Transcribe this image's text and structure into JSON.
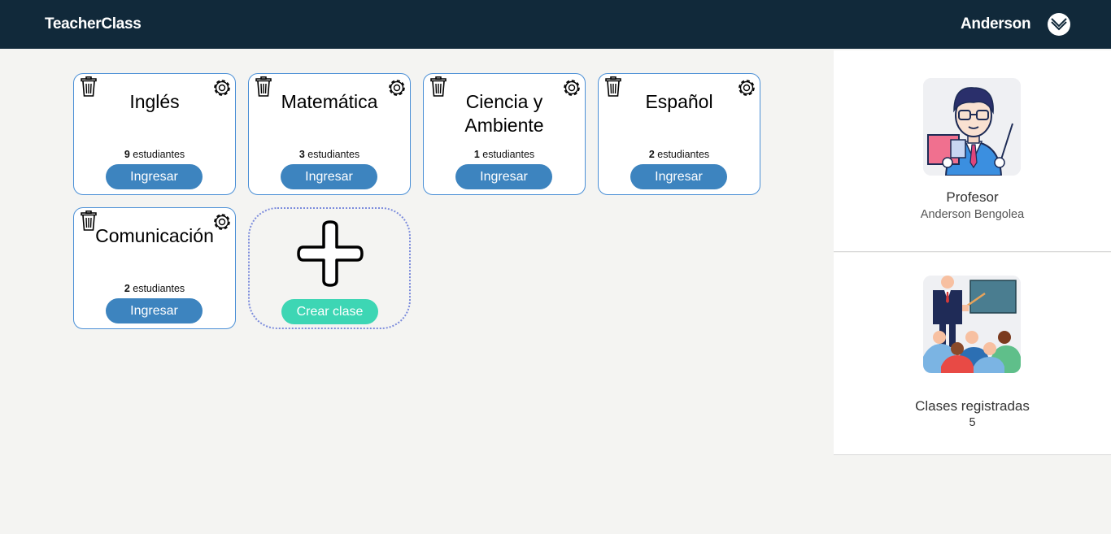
{
  "app": {
    "brand": "TeacherClass",
    "user_name": "Anderson"
  },
  "classes": [
    {
      "title": "Inglés",
      "count": "9",
      "count_label": "estudiantes",
      "button": "Ingresar"
    },
    {
      "title": "Matemática",
      "count": "3",
      "count_label": "estudiantes",
      "button": "Ingresar"
    },
    {
      "title": "Ciencia y Ambiente",
      "count": "1",
      "count_label": "estudiantes",
      "button": "Ingresar"
    },
    {
      "title": "Español",
      "count": "2",
      "count_label": "estudiantes",
      "button": "Ingresar"
    },
    {
      "title": "Comunicación",
      "count": "2",
      "count_label": "estudiantes",
      "button": "Ingresar"
    }
  ],
  "create": {
    "button": "Crear clase"
  },
  "profile": {
    "role": "Profesor",
    "name": "Anderson Bengolea"
  },
  "stats": {
    "label": "Clases registradas",
    "value": "5"
  },
  "colors": {
    "topbar": "#11293a",
    "primary_button": "#3d84bf",
    "create_button": "#3dd6b4",
    "card_border": "#4a8fd6"
  },
  "icons": {
    "delete": "trash-icon",
    "settings": "gear-icon",
    "menu": "chevron-down-icon",
    "add": "plus-icon"
  }
}
